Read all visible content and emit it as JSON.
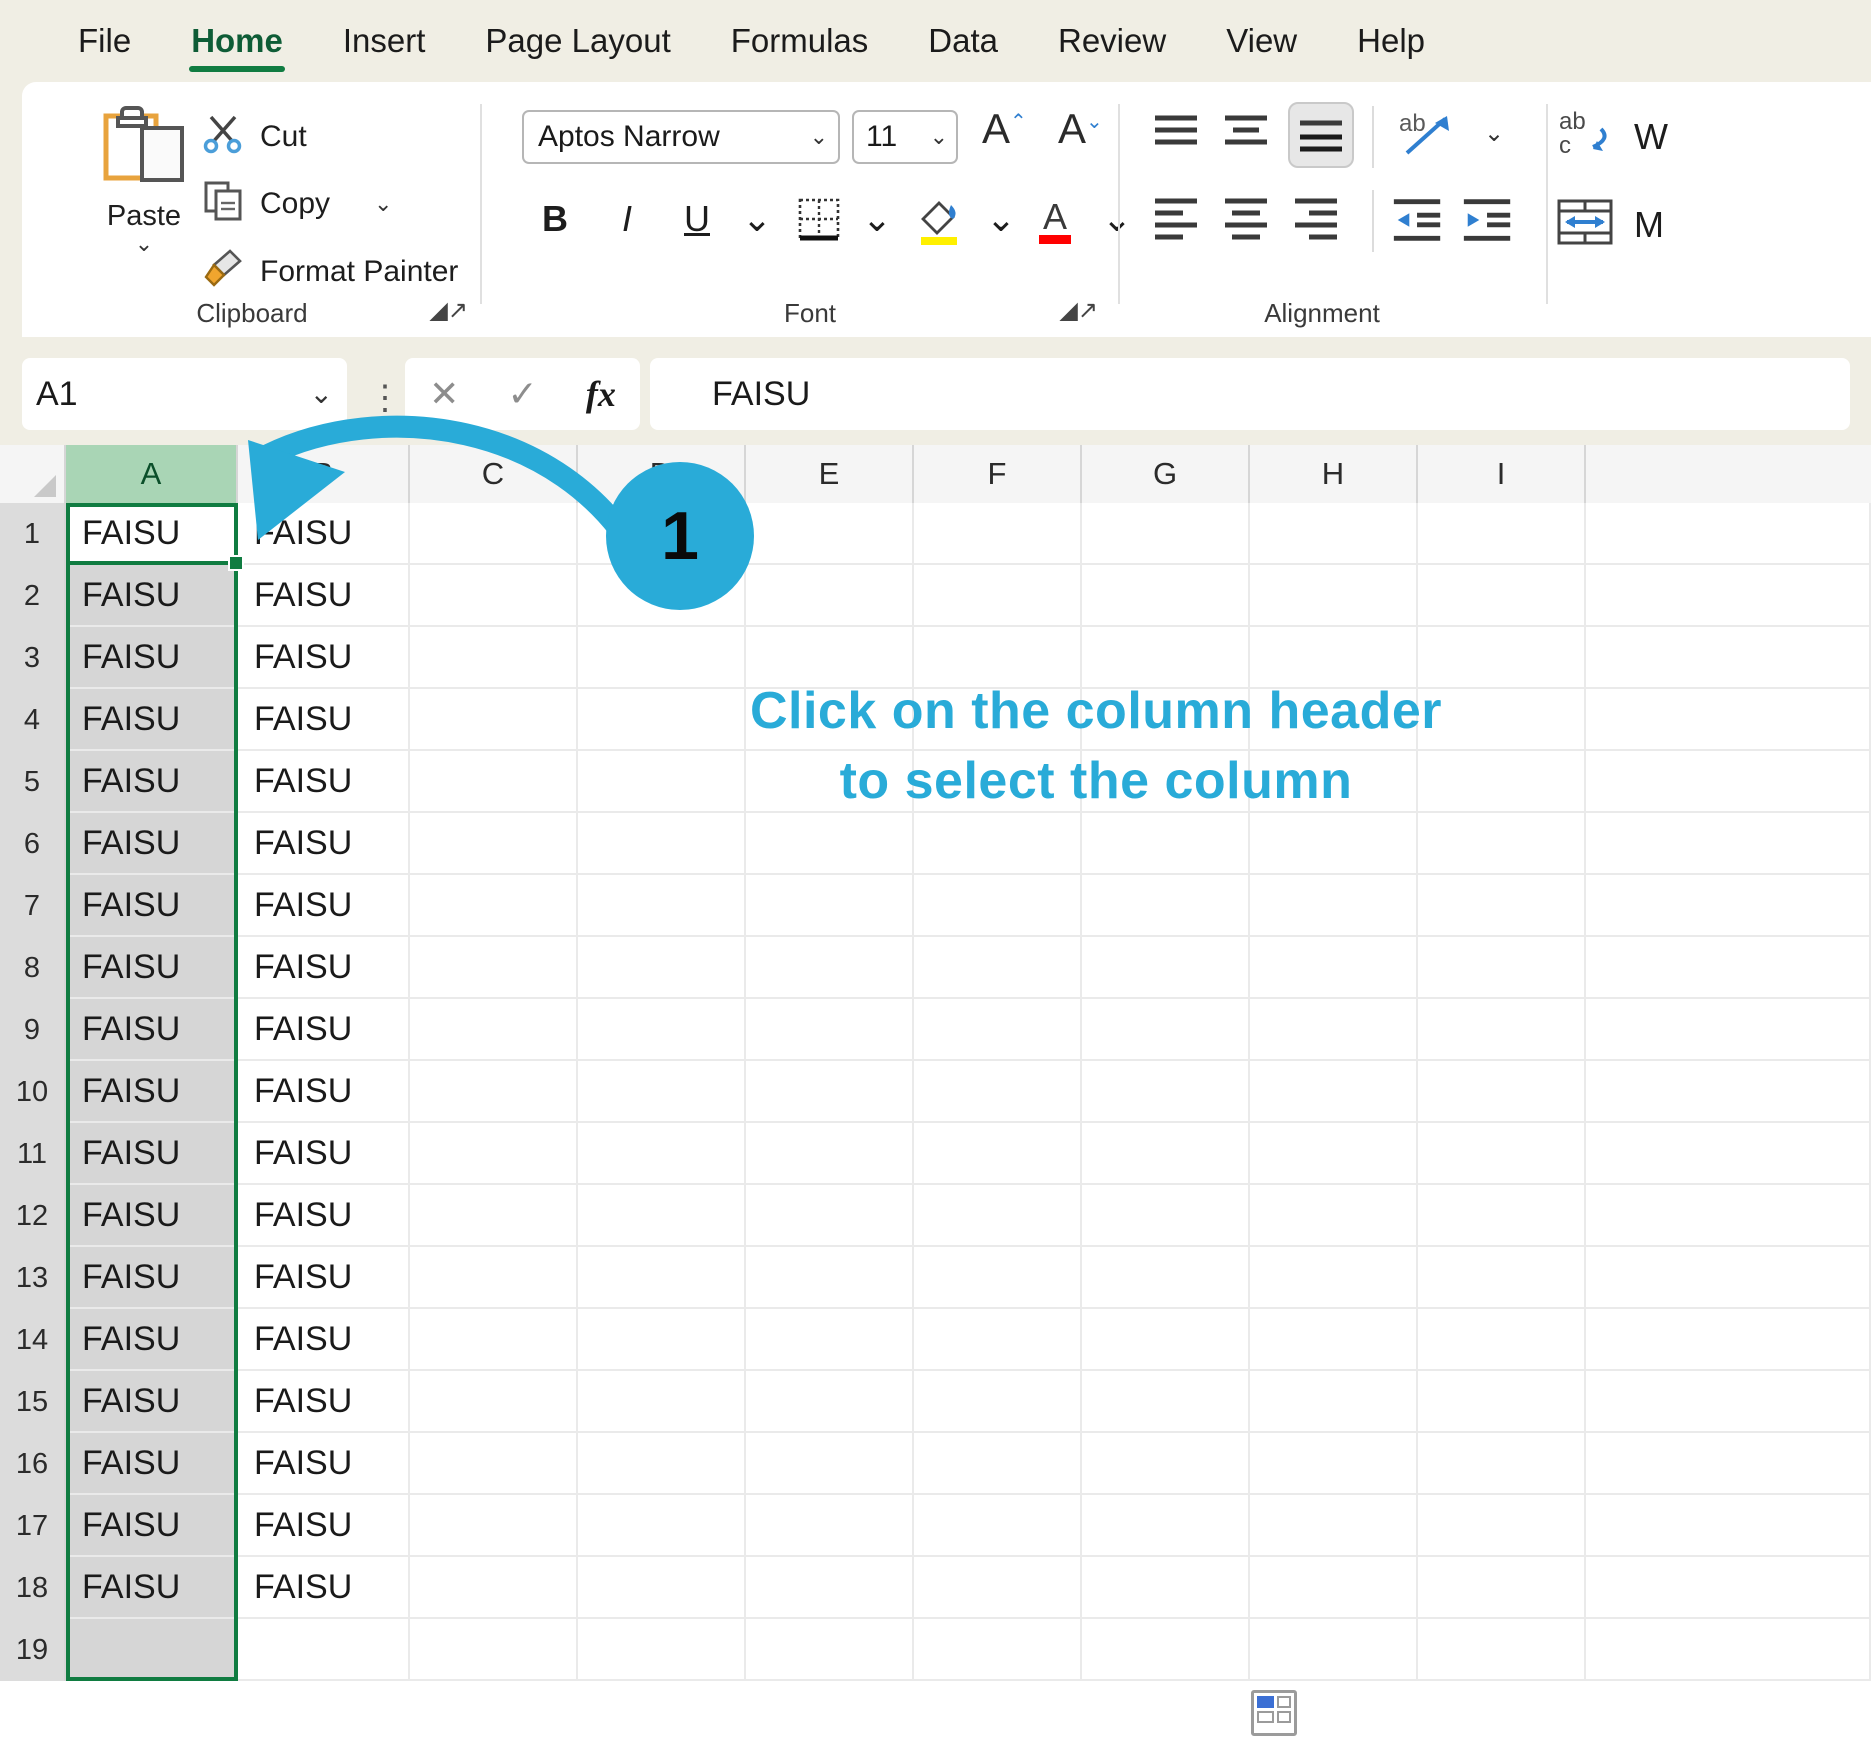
{
  "ribbon": {
    "tabs": [
      {
        "label": "File",
        "active": false
      },
      {
        "label": "Home",
        "active": true
      },
      {
        "label": "Insert",
        "active": false
      },
      {
        "label": "Page Layout",
        "active": false
      },
      {
        "label": "Formulas",
        "active": false
      },
      {
        "label": "Data",
        "active": false
      },
      {
        "label": "Review",
        "active": false
      },
      {
        "label": "View",
        "active": false
      },
      {
        "label": "Help",
        "active": false
      }
    ],
    "clipboard": {
      "group_label": "Clipboard",
      "paste_label": "Paste",
      "cut_label": "Cut",
      "copy_label": "Copy",
      "format_painter_label": "Format Painter"
    },
    "font": {
      "group_label": "Font",
      "font_name": "Aptos Narrow",
      "font_size": "11",
      "bold_label": "B",
      "italic_label": "I",
      "underline_label": "U"
    },
    "alignment": {
      "group_label": "Alignment"
    }
  },
  "formula_bar": {
    "name_box_value": "A1",
    "content": "FAISU",
    "cancel_icon": "cancel-icon",
    "enter_icon": "confirm-icon",
    "fx_icon": "fx"
  },
  "grid": {
    "columns": [
      "A",
      "B",
      "C",
      "D",
      "E",
      "F",
      "G",
      "H",
      "I"
    ],
    "selected_column": "A",
    "active_cell": "A1",
    "rows": [
      "1",
      "2",
      "3",
      "4",
      "5",
      "6",
      "7",
      "8",
      "9",
      "10",
      "11",
      "12",
      "13",
      "14",
      "15",
      "16",
      "17",
      "18",
      "19"
    ],
    "cell_value": "FAISU",
    "filled_rows": 18,
    "filled_columns": [
      "A",
      "B"
    ]
  },
  "annotation": {
    "step_number": "1",
    "line1": "Click on the column header",
    "line2": "to select the column",
    "accent_color": "#29ABD8"
  },
  "colors": {
    "excel_green": "#107C41",
    "ribbon_bg": "#F0EEE4",
    "header_selected": "#A9D5B5",
    "column_selected": "#D6D6D6"
  }
}
